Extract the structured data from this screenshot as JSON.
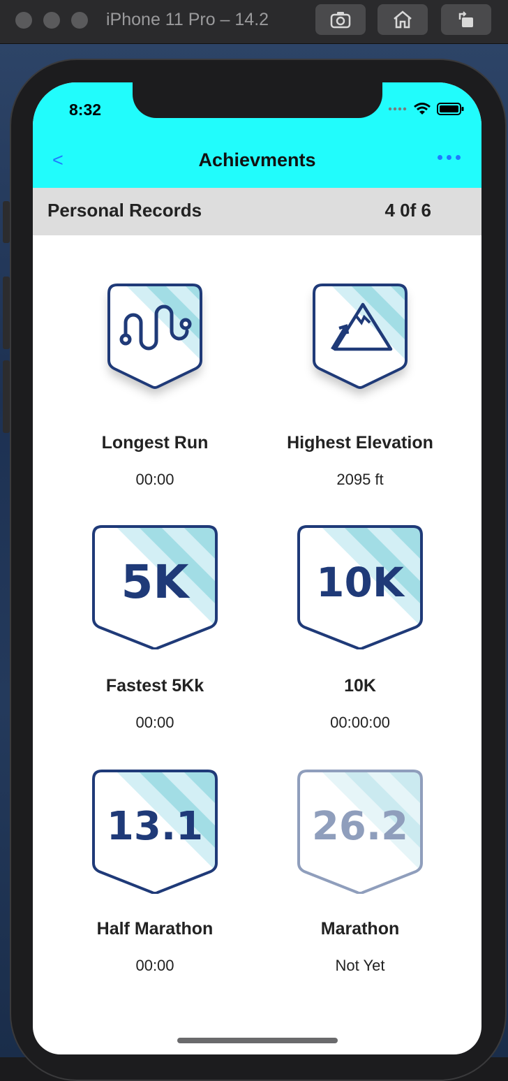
{
  "simulator": {
    "title": "iPhone 11 Pro – 14.2"
  },
  "status_bar": {
    "time": "8:32"
  },
  "nav": {
    "back": "<",
    "title": "Achievments"
  },
  "section": {
    "title": "Personal Records",
    "count": "4 0f 6"
  },
  "colors": {
    "header": "#21fcfc",
    "badge_dark": "#1f3a78",
    "badge_light": "#d3eff5",
    "badge_stripe": "#a2dde5",
    "accent": "#1e7bff"
  },
  "achievements": [
    {
      "title": "Longest Run",
      "value": "00:00",
      "icon": "route-icon",
      "locked": false
    },
    {
      "title": "Highest Elevation",
      "value": "2095 ft",
      "icon": "mountain-icon",
      "locked": false
    },
    {
      "title": "Fastest 5Kk",
      "value": "00:00",
      "badge_text": "5K",
      "locked": false
    },
    {
      "title": "10K",
      "value": "00:00:00",
      "badge_text": "10K",
      "locked": false
    },
    {
      "title": "Half Marathon",
      "value": "00:00",
      "badge_text": "13.1",
      "locked": false
    },
    {
      "title": "Marathon",
      "value": "Not Yet",
      "badge_text": "26.2",
      "locked": true
    }
  ]
}
